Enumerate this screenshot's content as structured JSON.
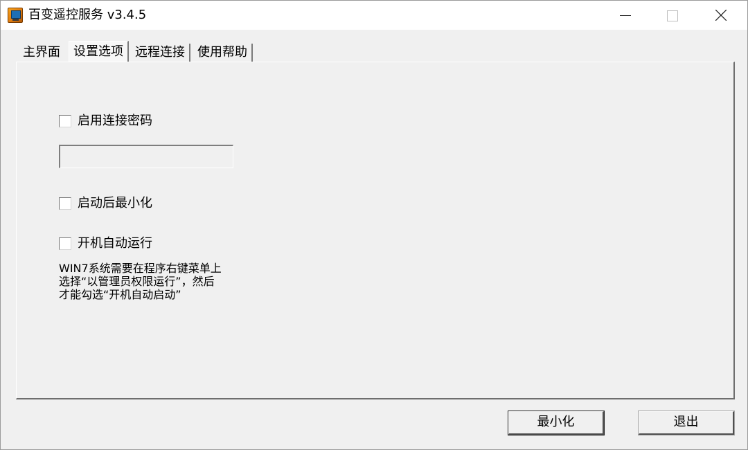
{
  "window": {
    "title": "百变遥控服务 v3.4.5"
  },
  "tabs": [
    {
      "label": "主界面",
      "active": false
    },
    {
      "label": "设置选项",
      "active": true
    },
    {
      "label": "远程连接",
      "active": false
    },
    {
      "label": "使用帮助",
      "active": false
    }
  ],
  "settings": {
    "enable_password_label": "启用连接密码",
    "enable_password_checked": false,
    "password_value": "",
    "start_minimized_label": "启动后最小化",
    "start_minimized_checked": false,
    "autostart_label": "开机自动运行",
    "autostart_checked": false,
    "note": "WIN7系统需要在程序右键菜单上\n选择“以管理员权限运行”，然后\n才能勾选“开机自动启动”"
  },
  "buttons": {
    "minimize_label": "最小化",
    "exit_label": "退出"
  }
}
